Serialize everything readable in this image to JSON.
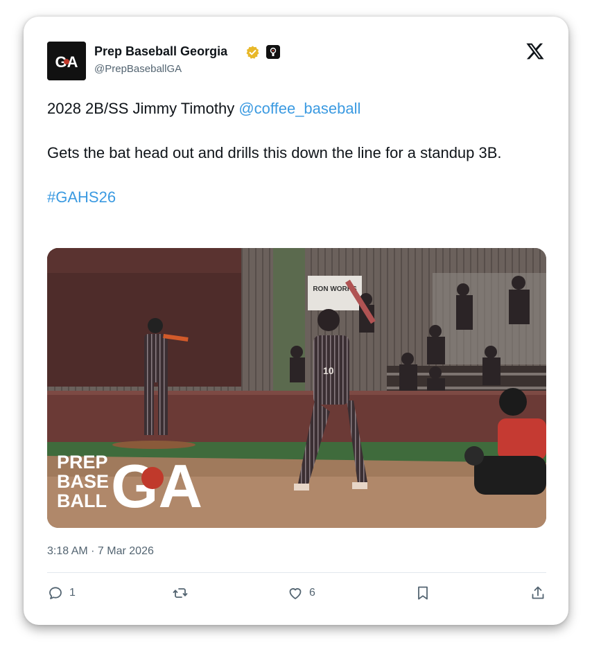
{
  "account": {
    "display_name": "Prep Baseball Georgia",
    "handle": "@PrepBaseballGA",
    "avatar_text": "GA"
  },
  "tweet": {
    "line1_prefix": "2028 2B/SS Jimmy Timothy ",
    "mention": "@coffee_baseball",
    "line2": "Gets the bat head out and drills this down the line for a standup 3B.",
    "hashtag": "#GAHS26",
    "timestamp": "3:18 AM · 7 Mar 2026"
  },
  "media": {
    "watermark_lines": [
      "PREP",
      "BASE",
      "BALL"
    ],
    "watermark_mark": "GA",
    "background_sign": "RON WORKS",
    "batter_jersey_number": "10"
  },
  "actions": {
    "reply_count": "1",
    "like_count": "6"
  },
  "colors": {
    "link": "#3b9ae1",
    "verified_badge": "#e8b829",
    "text_primary": "#0f1419",
    "text_secondary": "#536471"
  },
  "icons": [
    "verified-icon",
    "affiliate-badge-icon",
    "x-logo-icon",
    "reply-icon",
    "retweet-icon",
    "like-icon",
    "bookmark-icon",
    "share-icon"
  ]
}
